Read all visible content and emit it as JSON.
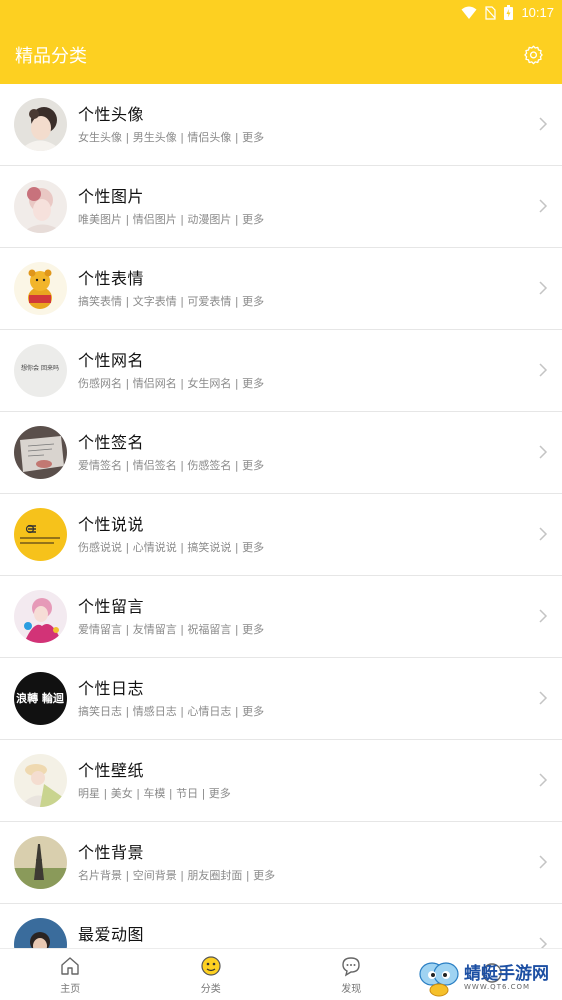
{
  "status": {
    "time": "10:17"
  },
  "appbar": {
    "title": "精品分类",
    "settings_icon": "gear-icon"
  },
  "categories": [
    {
      "title": "个性头像",
      "subtitle": "女生头像 | 男生头像 | 情侣头像 | 更多"
    },
    {
      "title": "个性图片",
      "subtitle": "唯美图片 | 情侣图片 | 动漫图片 | 更多"
    },
    {
      "title": "个性表情",
      "subtitle": "搞笑表情 | 文字表情 | 可爱表情 | 更多"
    },
    {
      "title": "个性网名",
      "subtitle": "伤感网名 | 情侣网名 | 女生网名 | 更多"
    },
    {
      "title": "个性签名",
      "subtitle": "爱情签名 | 情侣签名 | 伤感签名 | 更多"
    },
    {
      "title": "个性说说",
      "subtitle": "伤感说说 | 心情说说 | 搞笑说说 | 更多"
    },
    {
      "title": "个性留言",
      "subtitle": "爱情留言 | 友情留言 | 祝福留言 | 更多"
    },
    {
      "title": "个性日志",
      "subtitle": "搞笑日志 | 情感日志 | 心情日志 | 更多"
    },
    {
      "title": "个性壁纸",
      "subtitle": "明星 | 美女 | 车模 | 节日 | 更多"
    },
    {
      "title": "个性背景",
      "subtitle": "名片背景 | 空间背景 | 朋友圈封面 | 更多"
    },
    {
      "title": "最爱动图",
      "subtitle": ""
    }
  ],
  "avatar_text": {
    "wangming": "想你会 回来吗",
    "rizhi": "浪轉 輪迴"
  },
  "tabs": [
    {
      "label": "主页",
      "icon": "home-icon"
    },
    {
      "label": "分类",
      "icon": "category-icon"
    },
    {
      "label": "发现",
      "icon": "chat-bubble-icon"
    },
    {
      "label": "",
      "icon": "profile-icon"
    }
  ],
  "watermark": {
    "brand": "蜻蜓手游网",
    "url": "WWW.QT6.COM"
  },
  "colors": {
    "accent": "#fdd021",
    "divider": "#e6e6e6",
    "subtitle": "#8a8a8a"
  }
}
